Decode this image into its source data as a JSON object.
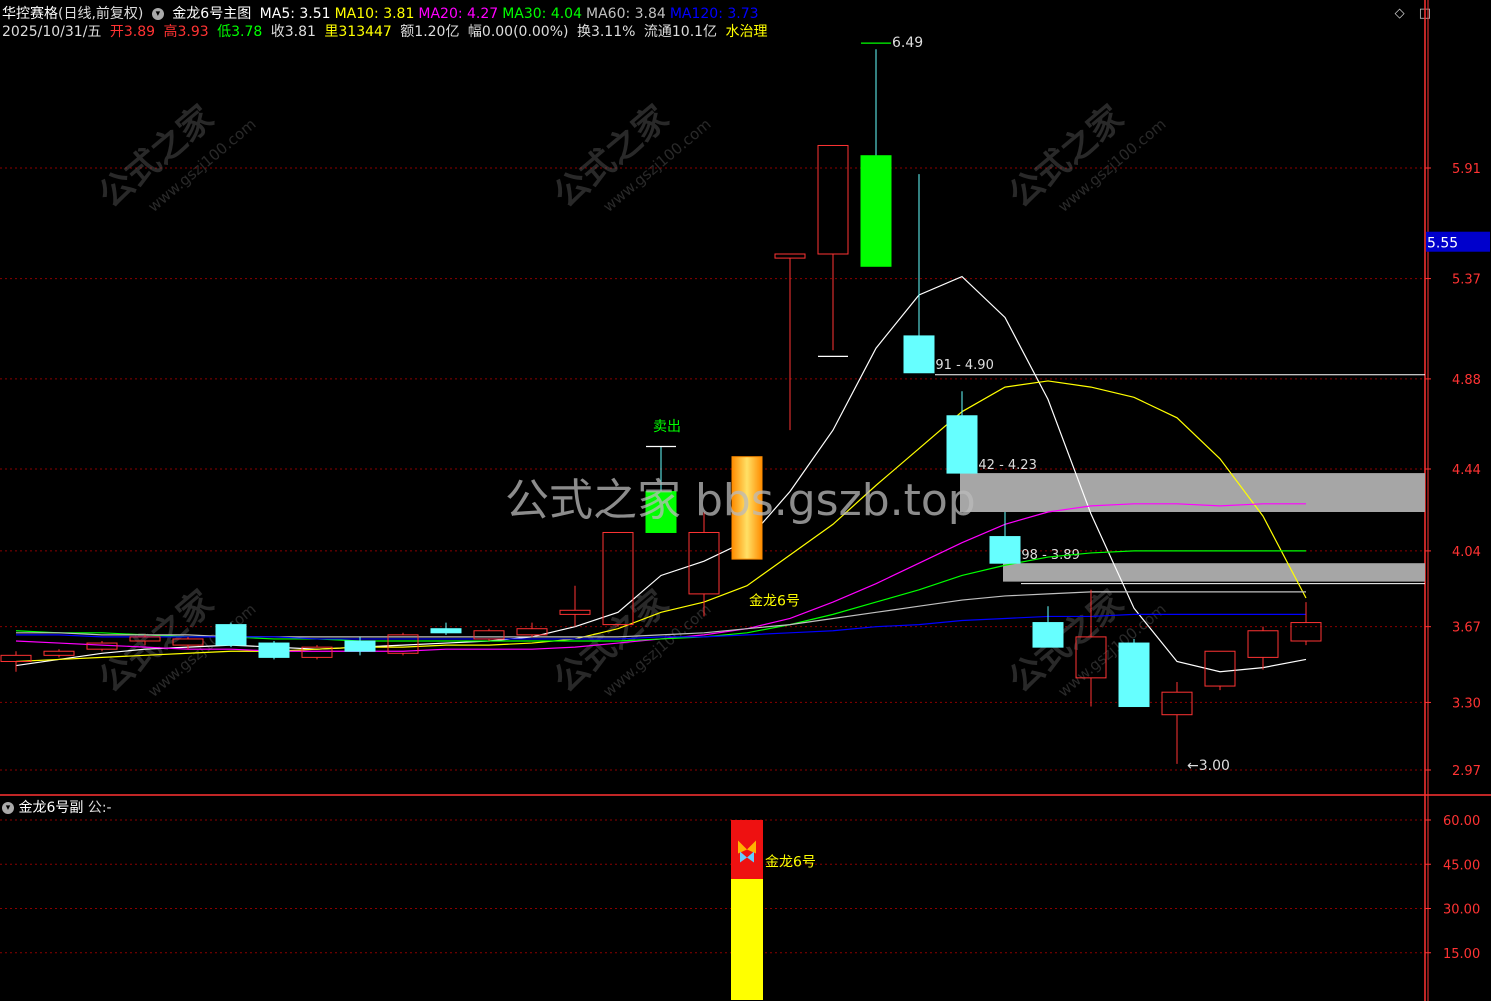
{
  "header": {
    "stock_name": "华控赛格",
    "period": "(日线,前复权)",
    "indicator": "金龙6号主图",
    "ma": [
      {
        "label": "MA5:",
        "value": "3.51",
        "color": "#ffffff"
      },
      {
        "label": "MA10:",
        "value": "3.81",
        "color": "#ffff00"
      },
      {
        "label": "MA20:",
        "value": "4.27",
        "color": "#ff00ff"
      },
      {
        "label": "MA30:",
        "value": "4.04",
        "color": "#00ff00"
      },
      {
        "label": "MA60:",
        "value": "3.84",
        "color": "#c0c0c0"
      },
      {
        "label": "MA120:",
        "value": "3.73",
        "color": "#0000ff"
      }
    ],
    "date": "2025/10/31/五",
    "open_label": "开",
    "open": "3.89",
    "high_label": "高",
    "high": "3.93",
    "low_label": "低",
    "low": "3.78",
    "close_label": "收",
    "close": "3.81",
    "volume_label": "里",
    "volume": "313447",
    "amount_label": "额",
    "amount": "1.20亿",
    "change_label": "幅",
    "change": "0.00(0.00%)",
    "turnover_label": "换",
    "turnover": "3.11%",
    "float_label": "流通",
    "float": "10.1亿",
    "industry": "水治理"
  },
  "toolbar": {
    "diamond_icon": "◇",
    "window_icon": "◫"
  },
  "sub_header": {
    "title": "金龙6号副",
    "formula": "公:-"
  },
  "watermarks": {
    "brand": "公式之家",
    "url": "www.gszj100.com",
    "center": "公式之家 bbs.gszb.top"
  },
  "colors": {
    "up": "#ff3333",
    "down_cyan": "#66ffff",
    "down_green": "#00ff00",
    "grid": "#8b0000",
    "axis": "#ff3333",
    "price_tag_bg": "#0000cc"
  },
  "chart_data": [
    {
      "type": "candlestick",
      "ylim": [
        2.88,
        6.55
      ],
      "y_ticks": [
        2.97,
        3.3,
        3.67,
        4.04,
        4.44,
        4.88,
        5.37,
        5.91
      ],
      "y_tick_labels": [
        "2.97",
        "3.30",
        "3.67",
        "4.04",
        "4.44",
        "4.88",
        "5.37",
        "5.91"
      ],
      "current_price_label": "5.55",
      "current_price": 5.55,
      "candles": [
        {
          "o": 3.5,
          "c": 3.53,
          "h": 3.55,
          "l": 3.45,
          "s": "up"
        },
        {
          "o": 3.53,
          "c": 3.55,
          "h": 3.56,
          "l": 3.52,
          "s": "up"
        },
        {
          "o": 3.56,
          "c": 3.59,
          "h": 3.6,
          "l": 3.55,
          "s": "up"
        },
        {
          "o": 3.6,
          "c": 3.62,
          "h": 3.63,
          "l": 3.58,
          "s": "up"
        },
        {
          "o": 3.58,
          "c": 3.61,
          "h": 3.62,
          "l": 3.56,
          "s": "up"
        },
        {
          "o": 3.68,
          "c": 3.58,
          "h": 3.69,
          "l": 3.57,
          "s": "cyan"
        },
        {
          "o": 3.59,
          "c": 3.52,
          "h": 3.6,
          "l": 3.51,
          "s": "cyan"
        },
        {
          "o": 3.52,
          "c": 3.57,
          "h": 3.58,
          "l": 3.51,
          "s": "up"
        },
        {
          "o": 3.6,
          "c": 3.55,
          "h": 3.62,
          "l": 3.53,
          "s": "cyan"
        },
        {
          "o": 3.54,
          "c": 3.63,
          "h": 3.64,
          "l": 3.53,
          "s": "up"
        },
        {
          "o": 3.66,
          "c": 3.64,
          "h": 3.69,
          "l": 3.63,
          "s": "cyan"
        },
        {
          "o": 3.61,
          "c": 3.65,
          "h": 3.66,
          "l": 3.6,
          "s": "up"
        },
        {
          "o": 3.63,
          "c": 3.66,
          "h": 3.69,
          "l": 3.62,
          "s": "up"
        },
        {
          "o": 3.73,
          "c": 3.75,
          "h": 3.87,
          "l": 3.67,
          "s": "up"
        },
        {
          "o": 3.68,
          "c": 4.13,
          "h": 4.13,
          "l": 3.67,
          "s": "up"
        },
        {
          "o": 4.33,
          "c": 4.13,
          "h": 4.55,
          "l": 4.13,
          "s": "green"
        },
        {
          "o": 3.83,
          "c": 4.13,
          "h": 4.23,
          "l": 3.72,
          "s": "up"
        },
        {
          "o": 4.0,
          "c": 4.5,
          "h": 4.5,
          "l": 4.0,
          "s": "gold"
        },
        {
          "o": 5.47,
          "c": 5.49,
          "h": 5.49,
          "l": 4.63,
          "s": "up"
        },
        {
          "o": 5.49,
          "c": 6.02,
          "h": 6.02,
          "l": 5.02,
          "s": "up"
        },
        {
          "o": 5.97,
          "c": 5.43,
          "h": 6.49,
          "l": 5.43,
          "s": "green"
        },
        {
          "o": 5.09,
          "c": 4.91,
          "h": 5.88,
          "l": 4.91,
          "s": "cyan"
        },
        {
          "o": 4.7,
          "c": 4.42,
          "h": 4.82,
          "l": 4.42,
          "s": "cyan"
        },
        {
          "o": 4.11,
          "c": 3.98,
          "h": 4.23,
          "l": 3.98,
          "s": "cyan"
        },
        {
          "o": 3.69,
          "c": 3.57,
          "h": 3.77,
          "l": 3.57,
          "s": "cyan"
        },
        {
          "o": 3.42,
          "c": 3.62,
          "h": 3.85,
          "l": 3.28,
          "s": "up"
        },
        {
          "o": 3.59,
          "c": 3.28,
          "h": 3.61,
          "l": 3.28,
          "s": "cyan"
        },
        {
          "o": 3.24,
          "c": 3.35,
          "h": 3.4,
          "l": 3.0,
          "s": "up"
        },
        {
          "o": 3.38,
          "c": 3.55,
          "h": 3.55,
          "l": 3.36,
          "s": "up"
        },
        {
          "o": 3.52,
          "c": 3.65,
          "h": 3.67,
          "l": 3.46,
          "s": "up"
        },
        {
          "o": 3.6,
          "c": 3.69,
          "h": 3.79,
          "l": 3.58,
          "s": "up"
        }
      ],
      "series": [
        {
          "name": "MA5",
          "color": "#ffffff",
          "values": [
            3.48,
            3.51,
            3.54,
            3.56,
            3.57,
            3.58,
            3.57,
            3.56,
            3.57,
            3.58,
            3.59,
            3.6,
            3.62,
            3.67,
            3.74,
            3.92,
            3.99,
            4.09,
            4.33,
            4.63,
            5.03,
            5.29,
            5.38,
            5.18,
            4.78,
            4.22,
            3.76,
            3.5,
            3.45,
            3.47,
            3.51
          ]
        },
        {
          "name": "MA10",
          "color": "#ffff00",
          "values": [
            3.5,
            3.51,
            3.52,
            3.53,
            3.54,
            3.55,
            3.55,
            3.56,
            3.57,
            3.57,
            3.58,
            3.58,
            3.59,
            3.61,
            3.66,
            3.74,
            3.79,
            3.87,
            4.02,
            4.17,
            4.36,
            4.54,
            4.72,
            4.84,
            4.87,
            4.84,
            4.79,
            4.69,
            4.49,
            4.21,
            3.81
          ]
        },
        {
          "name": "MA20",
          "color": "#ff00ff",
          "values": [
            3.6,
            3.59,
            3.58,
            3.57,
            3.56,
            3.56,
            3.55,
            3.55,
            3.55,
            3.55,
            3.56,
            3.56,
            3.56,
            3.57,
            3.59,
            3.61,
            3.63,
            3.66,
            3.71,
            3.79,
            3.88,
            3.98,
            4.08,
            4.17,
            4.23,
            4.26,
            4.27,
            4.27,
            4.26,
            4.27,
            4.27
          ]
        },
        {
          "name": "MA30",
          "color": "#00ff00",
          "values": [
            3.65,
            3.64,
            3.64,
            3.63,
            3.62,
            3.62,
            3.61,
            3.61,
            3.6,
            3.6,
            3.6,
            3.6,
            3.6,
            3.6,
            3.6,
            3.61,
            3.62,
            3.64,
            3.68,
            3.73,
            3.79,
            3.85,
            3.92,
            3.97,
            4.01,
            4.03,
            4.04,
            4.04,
            4.04,
            4.04,
            4.04
          ]
        },
        {
          "name": "MA60",
          "color": "#c0c0c0",
          "values": [
            3.64,
            3.64,
            3.63,
            3.63,
            3.63,
            3.62,
            3.62,
            3.62,
            3.62,
            3.62,
            3.62,
            3.62,
            3.62,
            3.62,
            3.62,
            3.63,
            3.64,
            3.66,
            3.68,
            3.71,
            3.74,
            3.77,
            3.8,
            3.82,
            3.83,
            3.84,
            3.84,
            3.84,
            3.84,
            3.84,
            3.84
          ]
        },
        {
          "name": "MA120",
          "color": "#0000ff",
          "values": [
            3.63,
            3.63,
            3.62,
            3.62,
            3.62,
            3.62,
            3.62,
            3.61,
            3.61,
            3.61,
            3.61,
            3.61,
            3.61,
            3.61,
            3.61,
            3.62,
            3.62,
            3.63,
            3.64,
            3.65,
            3.67,
            3.68,
            3.7,
            3.71,
            3.72,
            3.72,
            3.73,
            3.73,
            3.73,
            3.73,
            3.73
          ]
        }
      ],
      "support_lines": [
        {
          "price": 4.9,
          "from": 21,
          "color": "#ffffff"
        },
        {
          "price": 3.88,
          "from": 23,
          "color": "#ffffff"
        }
      ],
      "zones": [
        {
          "label": "4.91 - 4.90",
          "top": 4.91,
          "bottom": 4.9,
          "from": 21,
          "filled": false
        },
        {
          "label": "4.42 - 4.23",
          "top": 4.42,
          "bottom": 4.23,
          "from": 22,
          "filled": true
        },
        {
          "label": "3.98 - 3.89",
          "top": 3.98,
          "bottom": 3.89,
          "from": 23,
          "filled": true
        }
      ],
      "annotations": [
        {
          "text": "卖出",
          "index": 15,
          "price": 4.6,
          "color": "#00ff00"
        },
        {
          "text": "金龙6号",
          "index": 17,
          "price": 3.9,
          "color": "#ffff00"
        },
        {
          "text": "6.49",
          "index": 20,
          "price": 6.49,
          "color": "#dddddd"
        },
        {
          "text": "←3.00",
          "index": 27,
          "price": 3.0,
          "color": "#dddddd"
        }
      ],
      "dashes": [
        {
          "index": 15,
          "price": 4.55
        },
        {
          "index": 19,
          "price": 4.99
        },
        {
          "index": 20,
          "price": 6.52
        }
      ]
    },
    {
      "type": "bar",
      "ylim": [
        0,
        67
      ],
      "y_ticks": [
        15,
        30,
        45,
        60
      ],
      "y_tick_labels": [
        "15.00",
        "30.00",
        "45.00",
        "60.00"
      ],
      "bar": {
        "index": 17,
        "yellow_value": 40,
        "red_value": 60
      },
      "label": "金龙6号"
    }
  ]
}
